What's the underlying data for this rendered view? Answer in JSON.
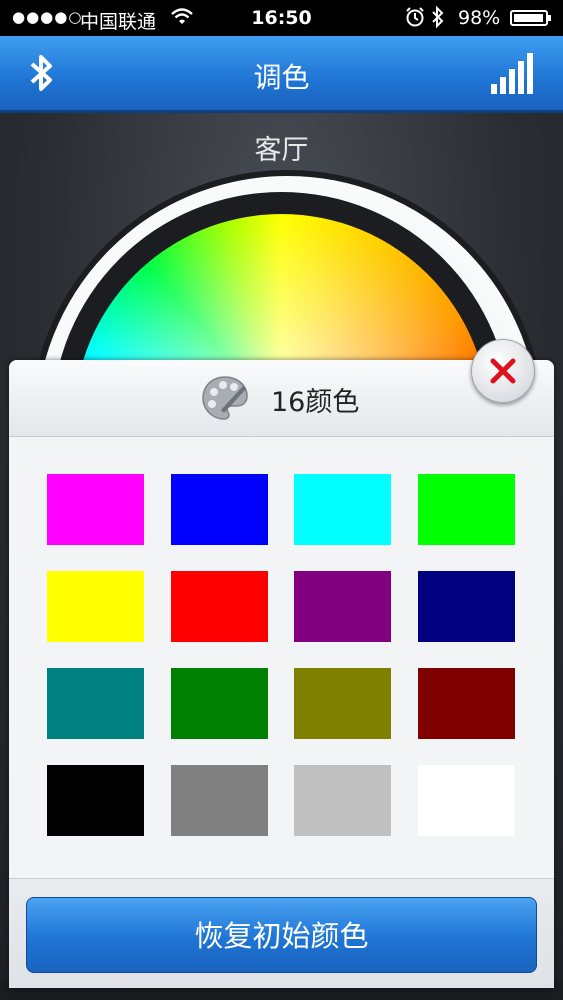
{
  "status_bar": {
    "signal": "●●●●○",
    "carrier": "中国联通",
    "time": "16:50",
    "battery_text": "98%",
    "battery_level": 0.98
  },
  "header": {
    "title": "调色",
    "left_icon": "bluetooth-icon",
    "right_icon": "signal-bars-icon"
  },
  "room": "客厅",
  "panel": {
    "title": "16颜色",
    "icon": "palette-icon",
    "close_icon": "close-icon",
    "swatches": [
      "#ff00ff",
      "#0000ff",
      "#00ffff",
      "#00ff00",
      "#ffff00",
      "#ff0000",
      "#800080",
      "#000080",
      "#008080",
      "#008000",
      "#808000",
      "#800000",
      "#000000",
      "#808080",
      "#c0c0c0",
      "#ffffff"
    ],
    "reset_label": "恢复初始颜色"
  }
}
